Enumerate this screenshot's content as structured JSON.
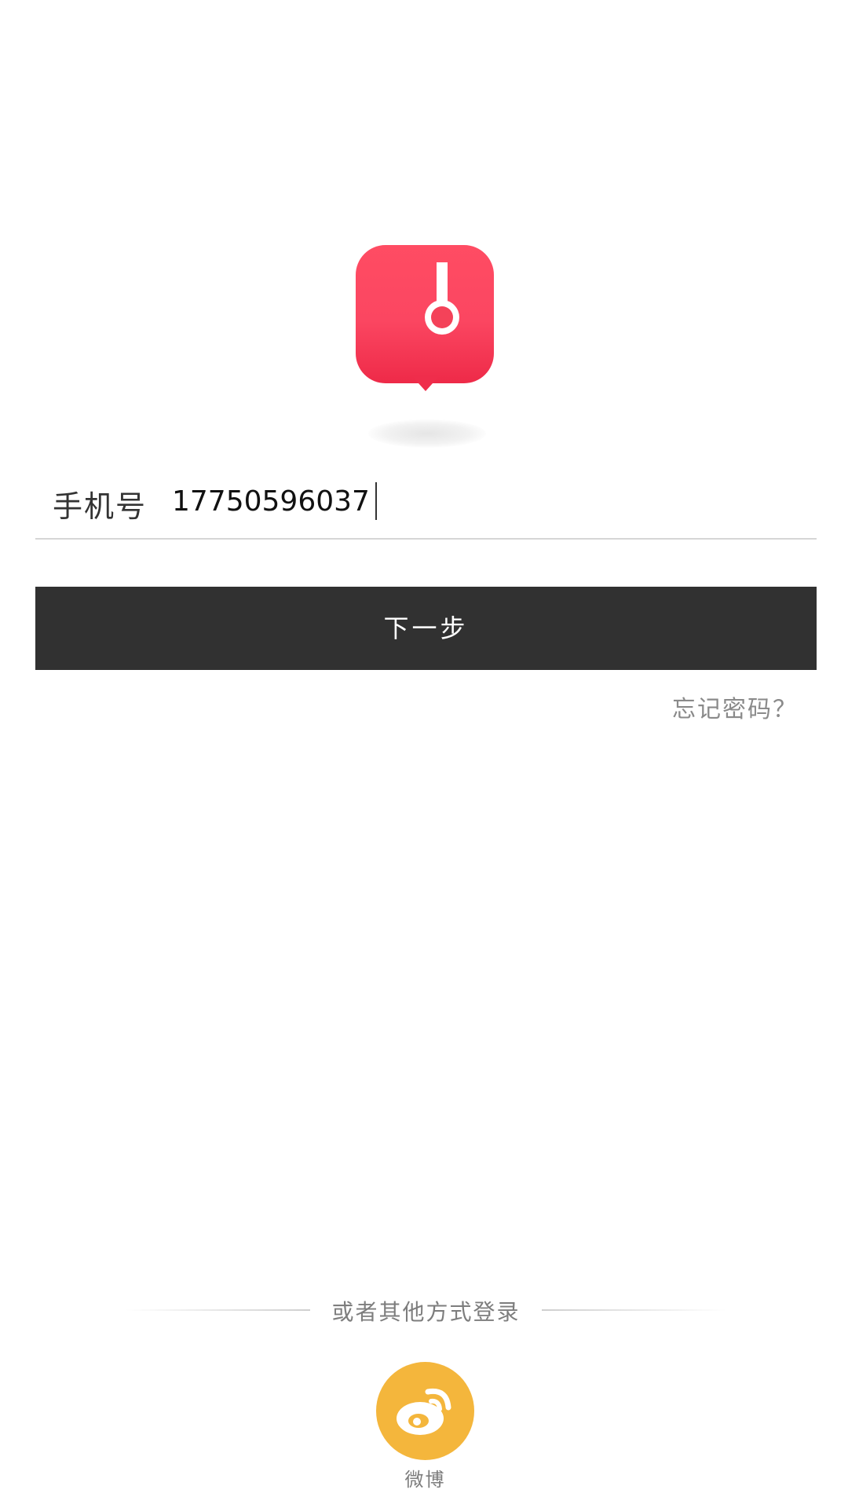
{
  "login": {
    "phone_label": "手机号",
    "phone_value": "17750596037",
    "next_label": "下一步",
    "forgot_label": "忘记密码？"
  },
  "other_login": {
    "divider_text": "或者其他方式登录",
    "weibo_label": "微博"
  },
  "icons": {
    "logo": "headphones-speech-bubble-icon",
    "weibo": "weibo-icon"
  },
  "colors": {
    "logo_red": "#fb4661",
    "button_dark": "#313131",
    "weibo_yellow": "#f4b63c"
  }
}
